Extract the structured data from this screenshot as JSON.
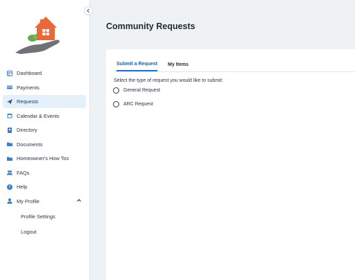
{
  "sidebar": {
    "collapse_icon": "chevron-left-icon",
    "logo": "house-in-hand-logo",
    "items": [
      {
        "label": "Dashboard",
        "icon": "dashboard-icon"
      },
      {
        "label": "Payments",
        "icon": "credit-card-icon"
      },
      {
        "label": "Requests",
        "icon": "send-icon",
        "active": true
      },
      {
        "label": "Calendar & Events",
        "icon": "calendar-icon"
      },
      {
        "label": "Directory",
        "icon": "contact-book-icon"
      },
      {
        "label": "Documents",
        "icon": "folder-icon"
      },
      {
        "label": "Homeowner's How Tos",
        "icon": "folder-icon"
      },
      {
        "label": "FAQs",
        "icon": "people-icon"
      },
      {
        "label": "Help",
        "icon": "help-circle-icon"
      },
      {
        "label": "My Profile",
        "icon": "user-icon",
        "expanded": true
      }
    ],
    "profile_sub_items": [
      "Profile Settings",
      "Logout"
    ]
  },
  "page": {
    "title": "Community Requests"
  },
  "tabs": [
    {
      "label": "Submit a Request",
      "active": true
    },
    {
      "label": "My Items",
      "active": false
    }
  ],
  "form": {
    "prompt": "Select the type of request you would like to submit:",
    "options": [
      "General Request",
      "ARC Request"
    ]
  },
  "colors": {
    "accent": "#1a73c8",
    "active_nav_bg": "#e6f0f8",
    "logo_orange": "#e8683a",
    "logo_green": "#6aa84f",
    "logo_gray": "#6e7277"
  }
}
